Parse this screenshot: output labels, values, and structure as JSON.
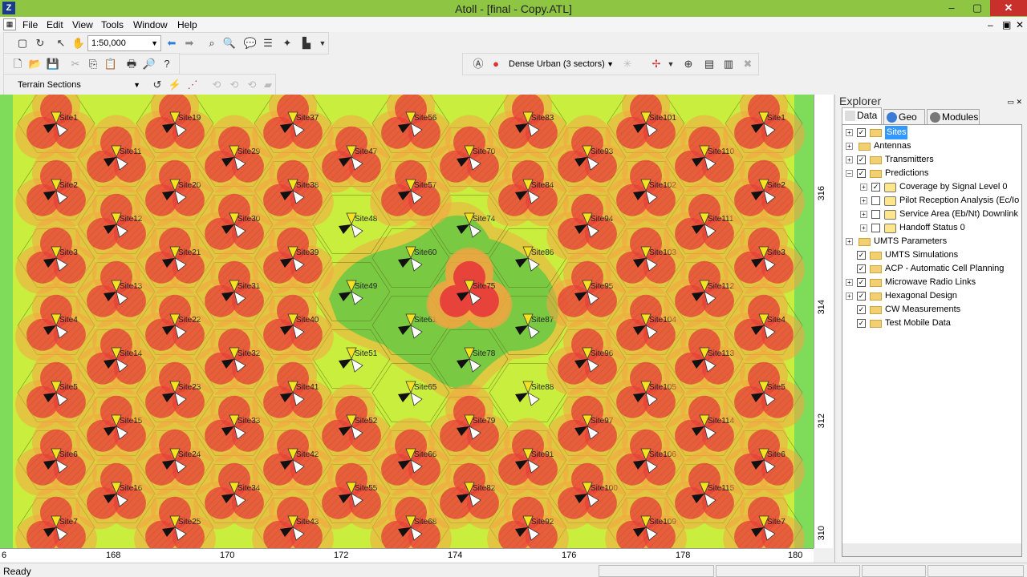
{
  "window": {
    "title": "Atoll - [final - Copy.ATL]",
    "minimize": "–",
    "maximize": "▢",
    "close": "✕"
  },
  "menu": [
    "File",
    "Edit",
    "View",
    "Tools",
    "Window",
    "Help"
  ],
  "toolbar": {
    "scale": "1:50,000",
    "template": "Dense Urban (3 sectors)",
    "terrain": "Terrain Sections"
  },
  "map": {
    "y_ticks": [
      "316",
      "314",
      "312",
      "310"
    ],
    "x_ticks": [
      "6",
      "168",
      "170",
      "172",
      "174",
      "176",
      "178",
      "180"
    ]
  },
  "sites": [
    "Site1",
    "Site2",
    "Site3",
    "Site4",
    "Site5",
    "Site6",
    "Site7",
    "Site11",
    "Site12",
    "Site13",
    "Site14",
    "Site15",
    "Site16",
    "Site19",
    "Site20",
    "Site21",
    "Site22",
    "Site23",
    "Site24",
    "Site25",
    "Site29",
    "Site30",
    "Site31",
    "Site32",
    "Site33",
    "Site34",
    "Site37",
    "Site38",
    "Site39",
    "Site40",
    "Site41",
    "Site42",
    "Site43",
    "Site47",
    "Site48",
    "Site49",
    "Site51",
    "Site52",
    "Site55",
    "Site56",
    "Site57",
    "Site60",
    "Site61",
    "Site65",
    "Site66",
    "Site68",
    "Site70",
    "Site74",
    "Site75",
    "Site78",
    "Site79",
    "Site82",
    "Site83",
    "Site84",
    "Site86",
    "Site87",
    "Site88",
    "Site91",
    "Site92",
    "Site93",
    "Site94",
    "Site95",
    "Site96",
    "Site97",
    "Site100",
    "Site101",
    "Site102",
    "Site103",
    "Site104",
    "Site105",
    "Site106",
    "Site109",
    "Site110",
    "Site111",
    "Site112",
    "Site113",
    "Site114",
    "Site115"
  ],
  "explorer": {
    "title": "Explorer",
    "tabs": [
      "Data",
      "Geo",
      "Modules"
    ],
    "tree": [
      {
        "label": "Sites",
        "expander": "+",
        "checked": true,
        "level": 0,
        "selected": true,
        "icon": "folder"
      },
      {
        "label": "Antennas",
        "expander": "+",
        "checked": null,
        "level": 0,
        "icon": "folder"
      },
      {
        "label": "Transmitters",
        "expander": "+",
        "checked": true,
        "level": 0,
        "icon": "folder"
      },
      {
        "label": "Predictions",
        "expander": "–",
        "checked": true,
        "level": 0,
        "icon": "folder"
      },
      {
        "label": "Coverage by Signal Level 0",
        "expander": "+",
        "checked": true,
        "level": 1,
        "icon": "prediction"
      },
      {
        "label": "Pilot Reception Analysis (Ec/Io",
        "expander": "+",
        "checked": false,
        "level": 1,
        "icon": "prediction"
      },
      {
        "label": "Service Area (Eb/Nt) Downlink",
        "expander": "+",
        "checked": false,
        "level": 1,
        "icon": "prediction"
      },
      {
        "label": "Handoff Status 0",
        "expander": "+",
        "checked": false,
        "level": 1,
        "icon": "prediction"
      },
      {
        "label": "UMTS Parameters",
        "expander": "+",
        "checked": null,
        "level": 0,
        "icon": "folder"
      },
      {
        "label": "UMTS Simulations",
        "expander": "",
        "checked": true,
        "level": 0,
        "icon": "folder"
      },
      {
        "label": "ACP - Automatic Cell Planning",
        "expander": "",
        "checked": true,
        "level": 0,
        "icon": "folder"
      },
      {
        "label": "Microwave Radio Links",
        "expander": "+",
        "checked": true,
        "level": 0,
        "icon": "folder"
      },
      {
        "label": "Hexagonal Design",
        "expander": "+",
        "checked": true,
        "level": 0,
        "icon": "folder"
      },
      {
        "label": "CW Measurements",
        "expander": "",
        "checked": true,
        "level": 0,
        "icon": "folder"
      },
      {
        "label": "Test Mobile Data",
        "expander": "",
        "checked": true,
        "level": 0,
        "icon": "folder"
      }
    ]
  },
  "status": {
    "text": "Ready"
  },
  "colors": {
    "titlebar": "#8ec542",
    "coverage_green": "#7ac943",
    "coverage_yellow": "#d9f23a",
    "coverage_orange": "#f5a442",
    "coverage_red": "#e8433a"
  }
}
